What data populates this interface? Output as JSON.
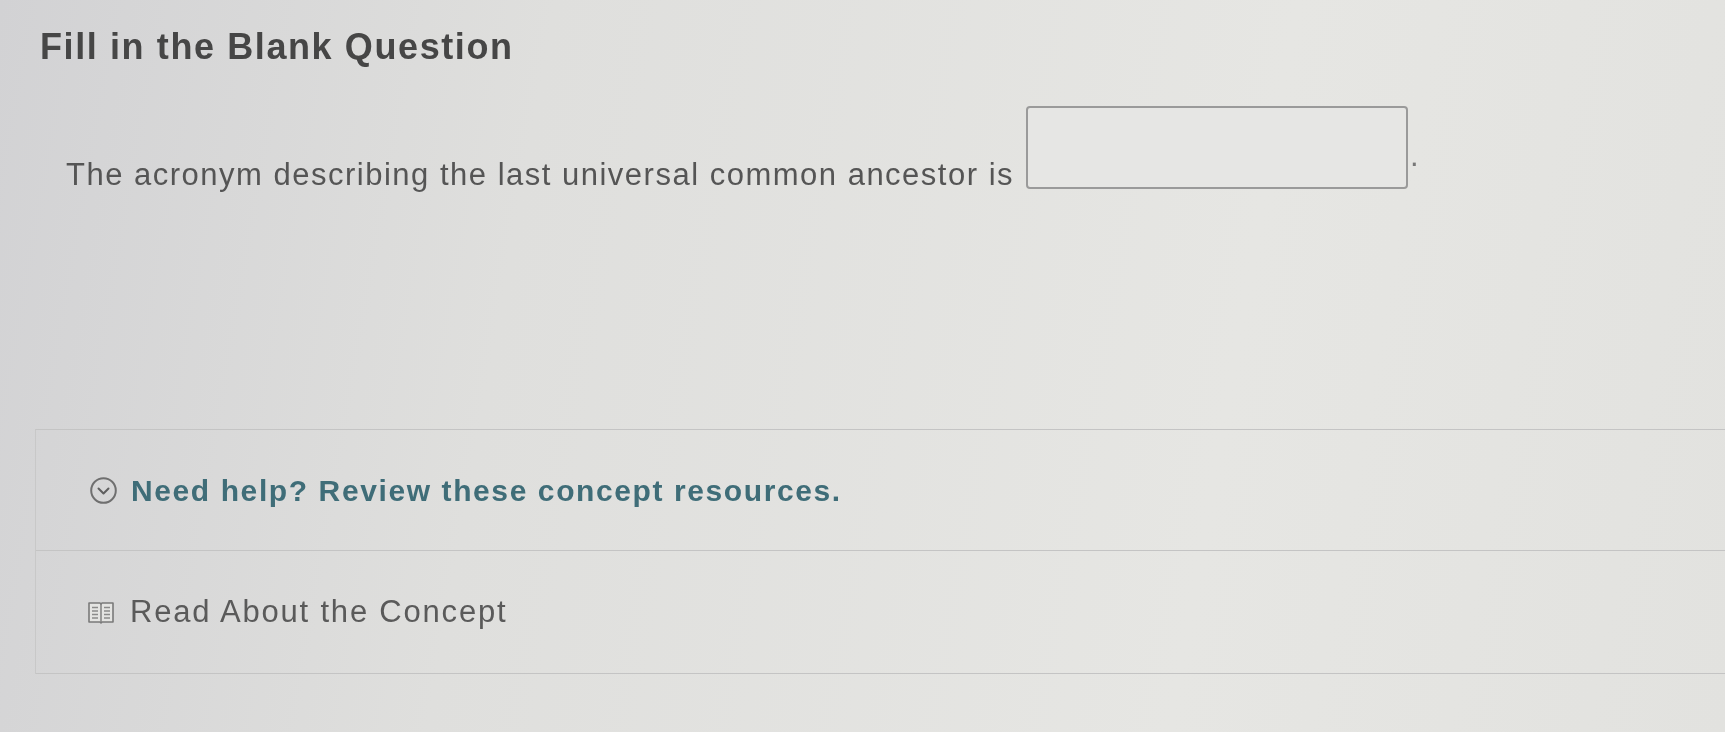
{
  "title": "Fill in the Blank Question",
  "question": {
    "parts": [
      {
        "kind": "text",
        "text": "The acronym describing the last universal common ancestor is"
      },
      {
        "kind": "blank"
      },
      {
        "kind": "text",
        "text": "."
      }
    ]
  },
  "help": {
    "toggle_label": "Need help? Review these concept resources.",
    "expanded": true,
    "resources": [
      {
        "label": "Read About the Concept"
      }
    ]
  }
}
